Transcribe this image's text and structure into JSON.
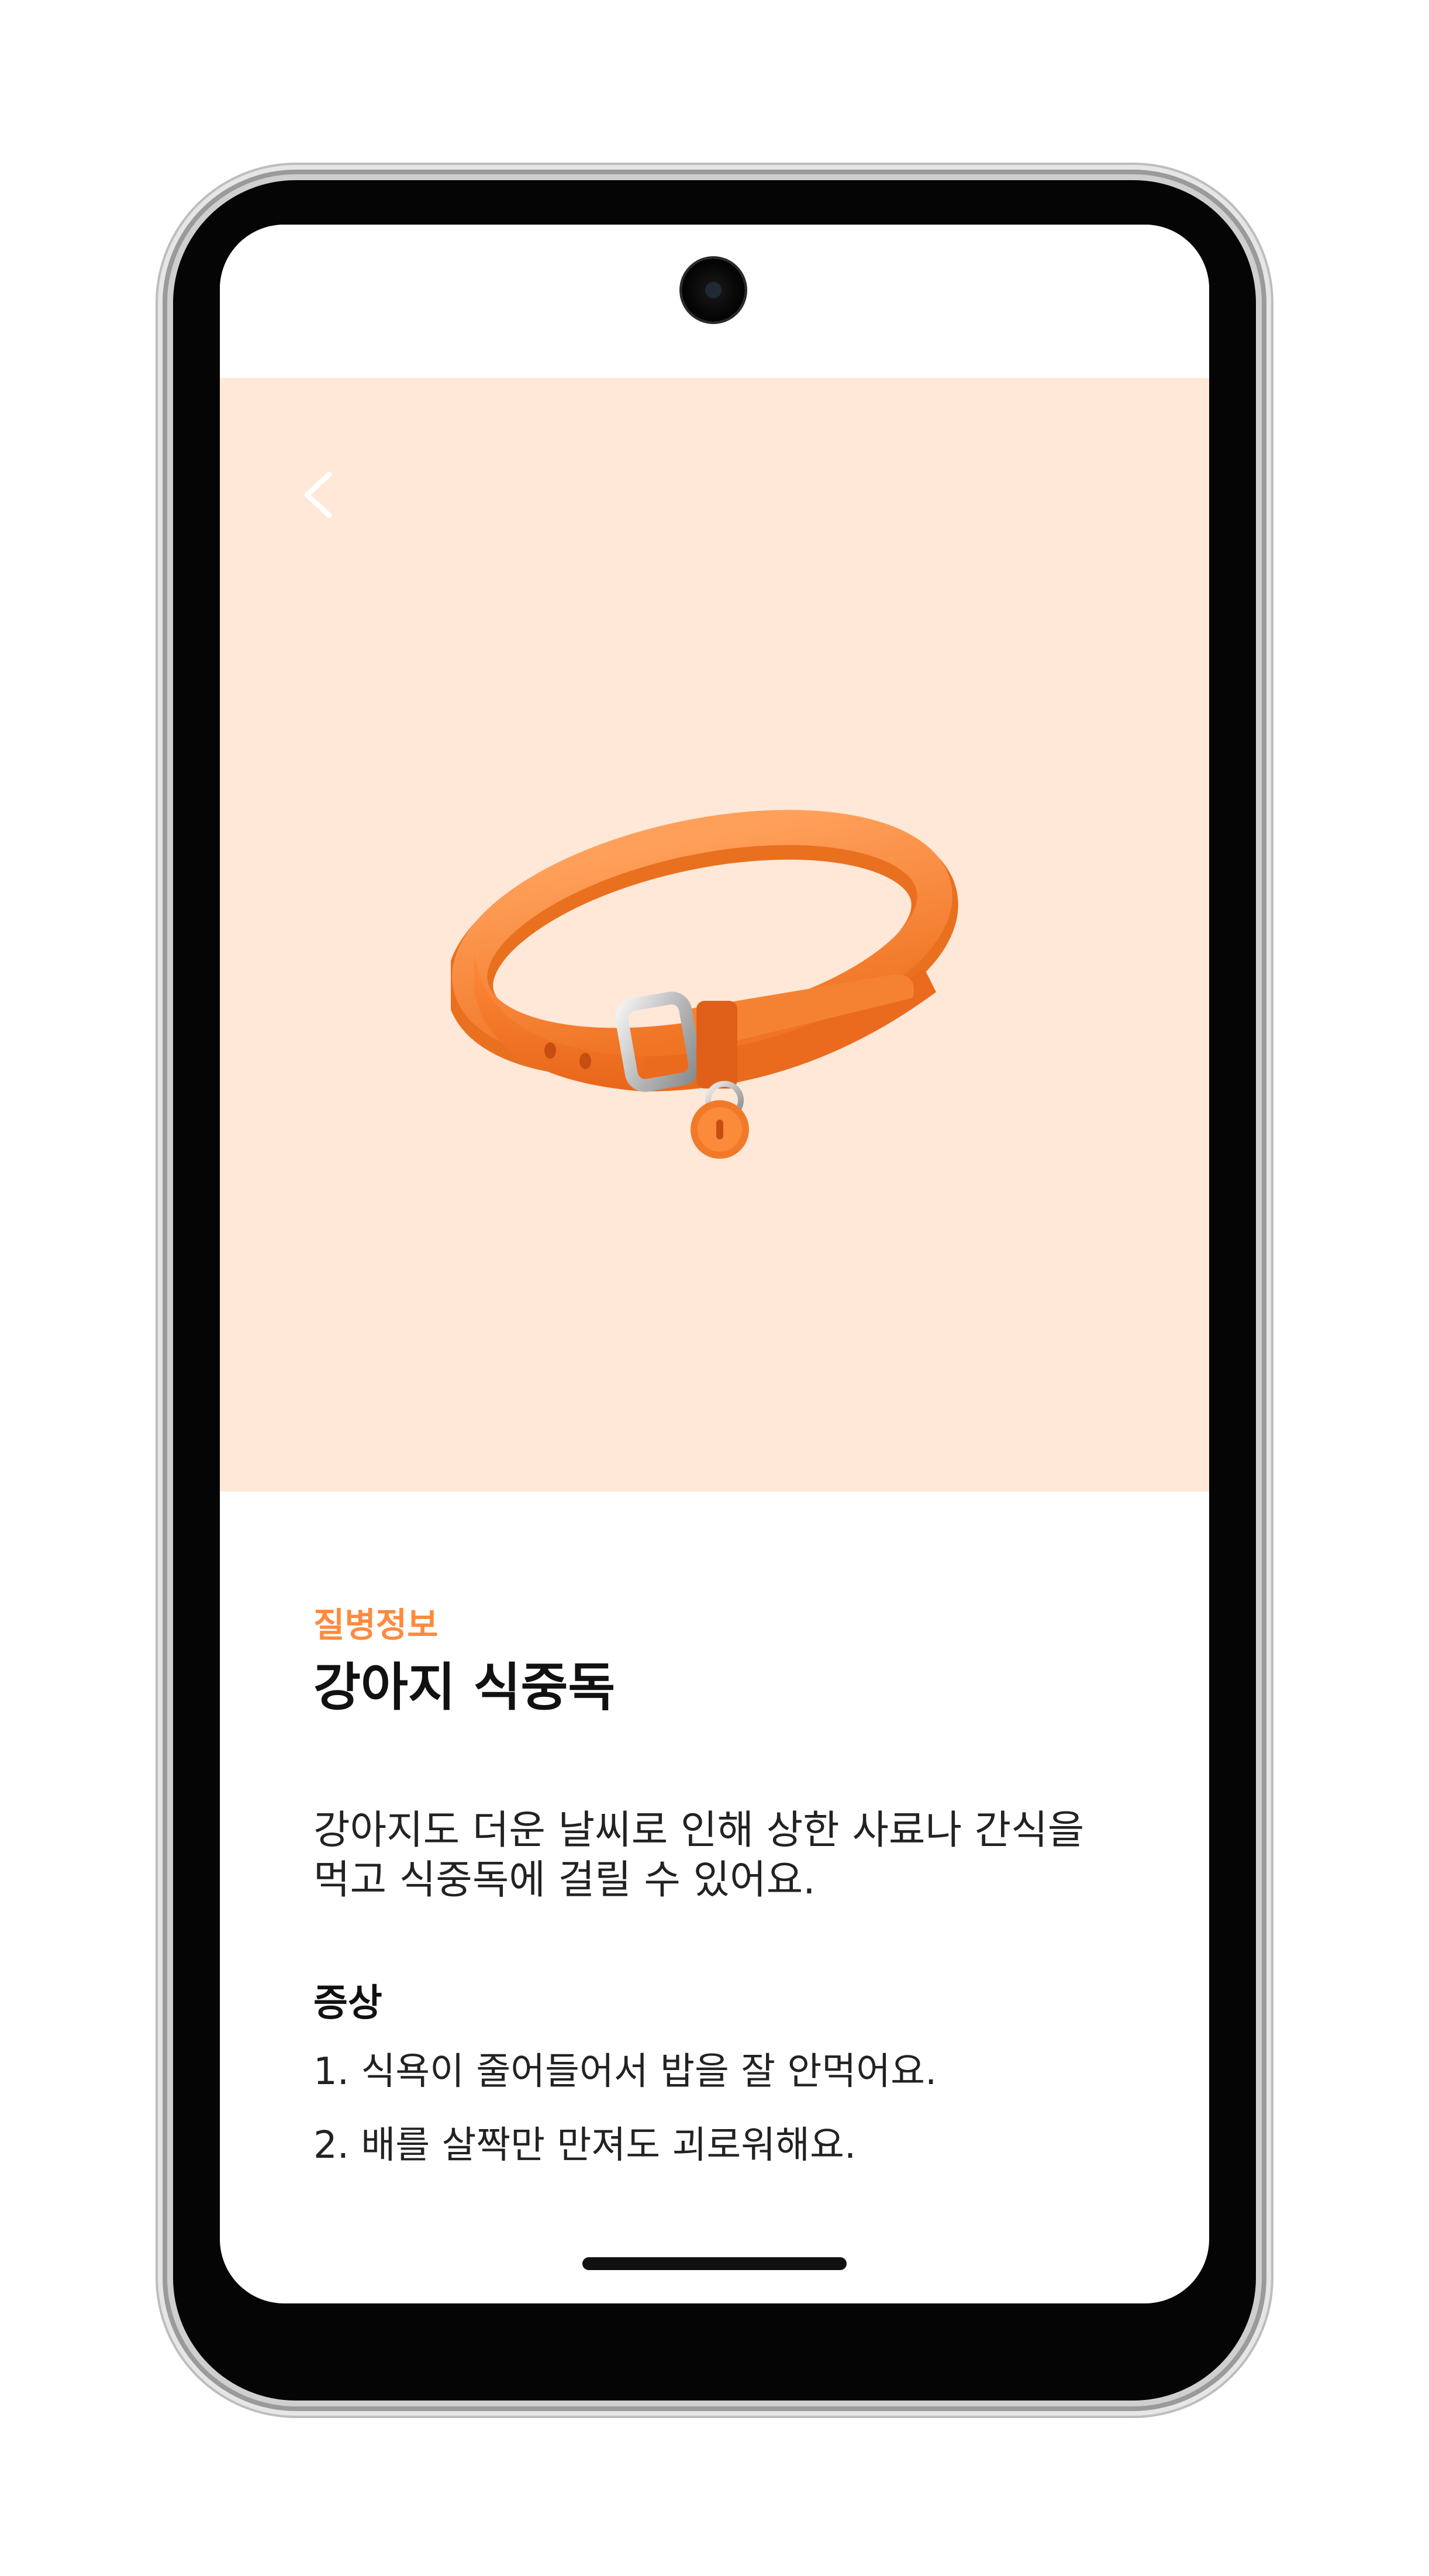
{
  "nav": {
    "back_icon": "chevron-left-icon"
  },
  "hero": {
    "background_color": "#ffe8d8",
    "illustration": "pet-collar-illustration"
  },
  "article": {
    "category": "질병정보",
    "title": "강아지 식중독",
    "description": "강아지도 더운 날씨로 인해 상한 사료나 간식을 먹고 식중독에 걸릴 수 있어요.",
    "symptoms_heading": "증상",
    "symptoms": [
      "1. 식욕이 줄어들어서 밥을 잘 안먹어요.",
      "2. 배를 살짝만 만져도 괴로워해요."
    ]
  },
  "colors": {
    "accent": "#ff8a3d",
    "text_primary": "#111111"
  }
}
